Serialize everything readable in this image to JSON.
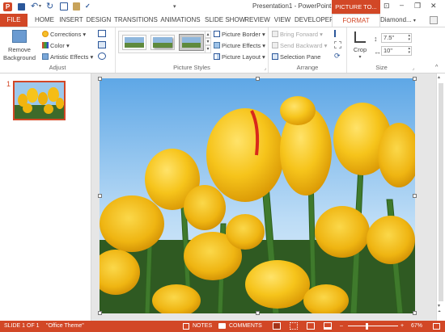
{
  "window": {
    "title": "Presentation1 - PowerPoint",
    "contextual_tab_group": "PICTURE TO...",
    "help": "?",
    "qat": {
      "undo_arrow": "▾",
      "more": "▾"
    },
    "controls": {
      "ribbon_display": "⊡",
      "minimize": "–",
      "restore": "❐",
      "close": "✕"
    }
  },
  "ribbon_tabs": [
    {
      "label": "FILE"
    },
    {
      "label": "HOME"
    },
    {
      "label": "INSERT"
    },
    {
      "label": "DESIGN"
    },
    {
      "label": "TRANSITIONS"
    },
    {
      "label": "ANIMATIONS"
    },
    {
      "label": "SLIDE SHOW"
    },
    {
      "label": "REVIEW"
    },
    {
      "label": "VIEW"
    },
    {
      "label": "DEVELOPER"
    },
    {
      "label": "FORMAT"
    }
  ],
  "account": {
    "name": "Diamond...",
    "dropdown": "▾"
  },
  "ribbon": {
    "adjust": {
      "remove_background_line1": "Remove",
      "remove_background_line2": "Background",
      "corrections": "Corrections ▾",
      "color": "Color ▾",
      "artistic_effects": "Artistic Effects ▾",
      "group_label": "Adjust"
    },
    "picture_styles": {
      "picture_border": "Picture Border ▾",
      "picture_effects": "Picture Effects ▾",
      "picture_layout": "Picture Layout ▾",
      "group_label": "Picture Styles"
    },
    "arrange": {
      "bring_forward": "Bring Forward ▾",
      "send_backward": "Send Backward ▾",
      "selection_pane": "Selection Pane",
      "group_label": "Arrange"
    },
    "size": {
      "crop": "Crop",
      "crop_arrow": "▾",
      "height": "7.5\"",
      "width": "10\"",
      "group_label": "Size"
    }
  },
  "slides": [
    {
      "number": "1"
    }
  ],
  "statusbar": {
    "slide_info": "SLIDE 1 OF 1",
    "theme": "\"Office Theme\"",
    "notes": "NOTES",
    "comments": "COMMENTS",
    "zoom": "67%"
  },
  "colors": {
    "accent": "#d24726",
    "tab_format": "#d24726",
    "status_bg": "#d24726"
  }
}
